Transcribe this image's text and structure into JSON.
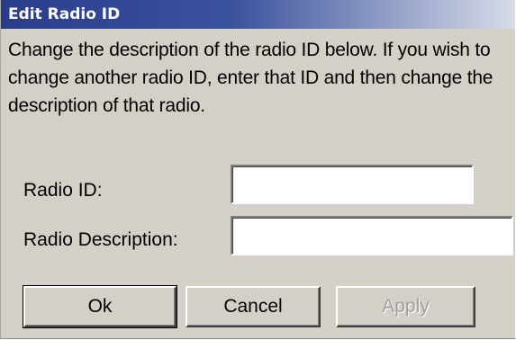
{
  "dialog": {
    "title": "Edit Radio ID",
    "instructions": "Change the description of the radio ID below. If you wish to change another radio ID, enter that ID and then change the description of that radio."
  },
  "fields": {
    "radio_id": {
      "label": "Radio ID:",
      "value": ""
    },
    "radio_description": {
      "label": "Radio Description:",
      "value": ""
    }
  },
  "buttons": {
    "ok": "Ok",
    "cancel": "Cancel",
    "apply": "Apply",
    "apply_enabled": false
  },
  "colors": {
    "titlebar_start": "#2a3d8a",
    "titlebar_end": "#d8dce8",
    "dialog_background": "#d4d0c8",
    "disabled_text": "#a0a0a0"
  }
}
